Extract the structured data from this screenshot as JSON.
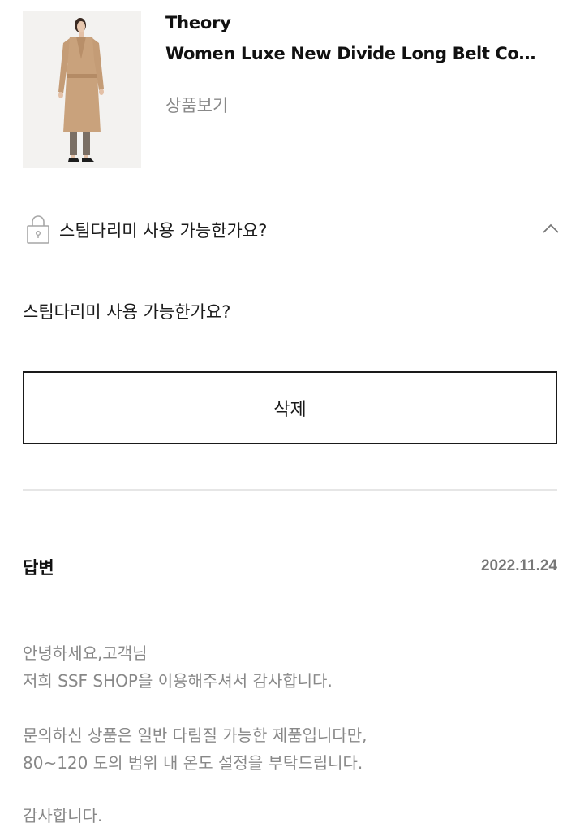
{
  "product": {
    "image_icon": "coat-model-photo",
    "brand": "Theory",
    "name": "Women Luxe New Divide Long Belt Coa...",
    "view_link": "상품보기"
  },
  "question": {
    "lock_icon": "lock-icon",
    "title": "스팀다리미 사용 가능한가요?",
    "toggle_icon": "chevron-up-icon",
    "body": "스팀다리미 사용 가능한가요?",
    "delete_label": "삭제"
  },
  "answer": {
    "label": "답변",
    "date": "2022.11.24",
    "lines": [
      "안녕하세요,고객님",
      "저희 SSF SHOP을 이용해주셔서 감사합니다.",
      "문의하신 상품은 일반 다림질 가능한 제품입니다만,",
      "80~120 도의 범위 내 온도 설정을 부탁드립니다.",
      "감사합니다."
    ]
  },
  "colors": {
    "text_primary": "#1a1a1a",
    "text_secondary": "#888888",
    "border": "#1a1a1a",
    "divider": "#e6e6e6",
    "coat": "#c9a27c"
  }
}
